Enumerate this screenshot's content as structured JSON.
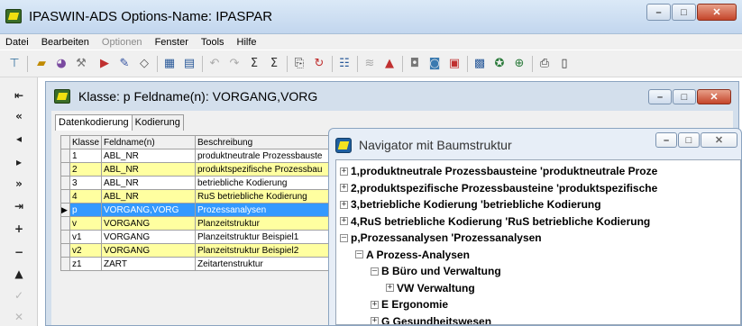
{
  "main_window": {
    "title": "IPASWIN-ADS   Options-Name: IPASPAR",
    "minimize": "–",
    "maximize": "□",
    "close": "✕"
  },
  "menu": [
    "Datei",
    "Bearbeiten",
    "Optionen",
    "Fenster",
    "Tools",
    "Hilfe"
  ],
  "menu_disabled": [
    "Optionen"
  ],
  "klasse_window": {
    "title": "Klasse: p   Feldname(n): VORGANG,VORG",
    "tabs": [
      "Datenkodierung",
      "Kodierung"
    ],
    "columns": [
      "Klasse",
      "Feldname(n)",
      "Beschreibung"
    ],
    "rows": [
      {
        "klasse": "1",
        "feld": "ABL_NR",
        "beschreibung": "produktneutrale Prozessbauste",
        "style": "normal"
      },
      {
        "klasse": "2",
        "feld": "ABL_NR",
        "beschreibung": "produktspezifische Prozessbau",
        "style": "highlight"
      },
      {
        "klasse": "3",
        "feld": "ABL_NR",
        "beschreibung": "betriebliche Kodierung",
        "style": "normal"
      },
      {
        "klasse": "4",
        "feld": "ABL_NR",
        "beschreibung": "RuS betriebliche Kodierung",
        "style": "highlight"
      },
      {
        "klasse": "p",
        "feld": "VORGANG,VORG",
        "beschreibung": "Prozessanalysen",
        "style": "current"
      },
      {
        "klasse": "v",
        "feld": "VORGANG",
        "beschreibung": "Planzeitstruktur",
        "style": "highlight"
      },
      {
        "klasse": "v1",
        "feld": "VORGANG",
        "beschreibung": "Planzeitstruktur Beispiel1",
        "style": "normal"
      },
      {
        "klasse": "v2",
        "feld": "VORGANG",
        "beschreibung": "Planzeitstruktur Beispiel2",
        "style": "highlight"
      },
      {
        "klasse": "z1",
        "feld": "ZART",
        "beschreibung": "Zeitartenstruktur",
        "style": "normal"
      }
    ]
  },
  "navigator_window": {
    "title": "Navigator mit Baumstruktur",
    "tree": [
      {
        "label": "1,produktneutrale Prozessbausteine 'produktneutrale Proze",
        "level": 0,
        "expander": "+"
      },
      {
        "label": "2,produktspezifische Prozessbausteine 'produktspezifische",
        "level": 0,
        "expander": "+"
      },
      {
        "label": "3,betriebliche Kodierung 'betriebliche Kodierung",
        "level": 0,
        "expander": "+"
      },
      {
        "label": "4,RuS betriebliche Kodierung 'RuS betriebliche Kodierung",
        "level": 0,
        "expander": "+"
      },
      {
        "label": "p,Prozessanalysen 'Prozessanalysen",
        "level": 0,
        "expander": "–"
      },
      {
        "label": "A Prozess-Analysen",
        "level": 1,
        "expander": "–"
      },
      {
        "label": "B Büro und Verwaltung",
        "level": 2,
        "expander": "–"
      },
      {
        "label": "VW Verwaltung",
        "level": 3,
        "expander": "+"
      },
      {
        "label": "E Ergonomie",
        "level": 2,
        "expander": "+"
      },
      {
        "label": "G Gesundheitswesen",
        "level": 2,
        "expander": "+"
      }
    ]
  },
  "colors": {
    "highlight_row": "#ffffa0",
    "current_row": "#3399ff",
    "title_bar": "#c2d6ee"
  }
}
